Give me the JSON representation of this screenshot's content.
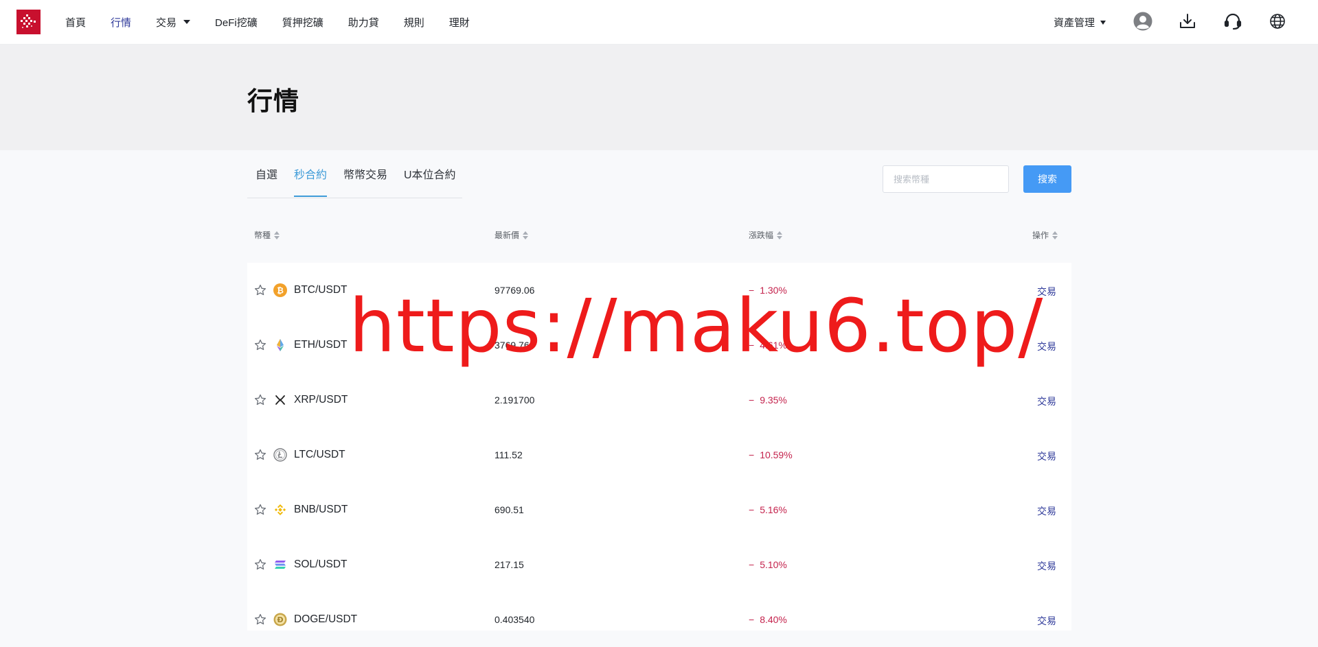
{
  "nav": {
    "items": [
      {
        "label": "首頁",
        "active": false,
        "dropdown": false
      },
      {
        "label": "行情",
        "active": true,
        "dropdown": false
      },
      {
        "label": "交易",
        "active": false,
        "dropdown": true
      },
      {
        "label": "DeFi挖礦",
        "active": false,
        "dropdown": false
      },
      {
        "label": "質押挖礦",
        "active": false,
        "dropdown": false
      },
      {
        "label": "助力貸",
        "active": false,
        "dropdown": false
      },
      {
        "label": "規則",
        "active": false,
        "dropdown": false
      },
      {
        "label": "理財",
        "active": false,
        "dropdown": false
      }
    ],
    "asset_menu_label": "資產管理",
    "icons": [
      "user-avatar-icon",
      "download-icon",
      "headset-icon",
      "globe-icon"
    ]
  },
  "header": {
    "title": "行情"
  },
  "tabs": {
    "items": [
      "自選",
      "秒合約",
      "幣幣交易",
      "U本位合約"
    ],
    "active_index": 1
  },
  "search": {
    "placeholder": "搜索幣種",
    "value": "",
    "button_label": "搜索"
  },
  "table": {
    "headers": {
      "coin": "幣種",
      "price": "最新價",
      "change": "漲跌幅",
      "action": "操作"
    },
    "rows": [
      {
        "pair": "BTC/USDT",
        "icon": "btc-icon",
        "price": "97769.06",
        "change_sign": "−",
        "change": "1.30%",
        "action": "交易"
      },
      {
        "pair": "ETH/USDT",
        "icon": "eth-icon",
        "price": "3769.76",
        "change_sign": "−",
        "change": "4.61%",
        "action": "交易"
      },
      {
        "pair": "XRP/USDT",
        "icon": "xrp-icon",
        "price": "2.191700",
        "change_sign": "−",
        "change": "9.35%",
        "action": "交易"
      },
      {
        "pair": "LTC/USDT",
        "icon": "ltc-icon",
        "price": "111.52",
        "change_sign": "−",
        "change": "10.59%",
        "action": "交易"
      },
      {
        "pair": "BNB/USDT",
        "icon": "bnb-icon",
        "price": "690.51",
        "change_sign": "−",
        "change": "5.16%",
        "action": "交易"
      },
      {
        "pair": "SOL/USDT",
        "icon": "sol-icon",
        "price": "217.15",
        "change_sign": "−",
        "change": "5.10%",
        "action": "交易"
      },
      {
        "pair": "DOGE/USDT",
        "icon": "doge-icon",
        "price": "0.403540",
        "change_sign": "−",
        "change": "8.40%",
        "action": "交易"
      }
    ]
  },
  "colors": {
    "accent": "#3d9bd8",
    "nav_active": "#2f3a9a",
    "negative": "#c4224c",
    "button": "#459af5",
    "logo": "#c8102e",
    "watermark": "#ee1b1b"
  },
  "overlay": {
    "watermark_text": "https://maku6.top/"
  }
}
